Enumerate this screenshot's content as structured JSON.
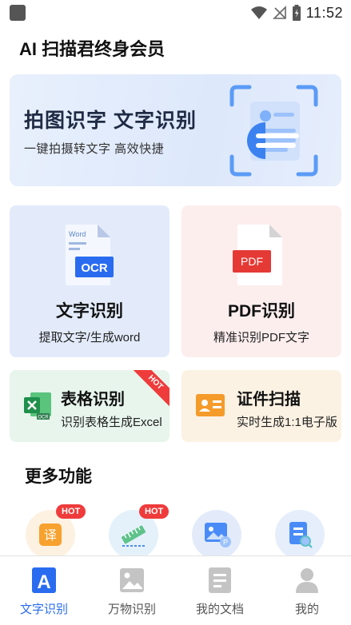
{
  "status_bar": {
    "time": "11:52",
    "icons": [
      "notification-icon",
      "wifi-icon",
      "signal-off-icon",
      "battery-charging-icon"
    ]
  },
  "header": {
    "title": "AI 扫描君终身会员"
  },
  "banner": {
    "title": "拍图识字  文字识别",
    "subtitle": "一键拍摄转文字  高效快捷",
    "accent": "#4a8cf7"
  },
  "cards": {
    "ocr": {
      "title": "文字识别",
      "subtitle": "提取文字/生成word",
      "icon_label": "OCR",
      "icon_tag": "Word",
      "icon": "ocr-document-icon"
    },
    "pdf": {
      "title": "PDF识别",
      "subtitle": "精准识别PDF文字",
      "icon_label": "PDF",
      "icon": "pdf-document-icon"
    },
    "table": {
      "title": "表格识别",
      "subtitle": "识别表格生成Excel",
      "badge": "HOT",
      "icon_tag": "OCR",
      "icon": "excel-icon"
    },
    "id": {
      "title": "证件扫描",
      "subtitle": "实时生成1:1电子版",
      "icon": "id-card-icon"
    }
  },
  "more": {
    "title": "更多功能",
    "items": [
      {
        "icon": "translate-icon",
        "glyph": "译",
        "badge": "HOT"
      },
      {
        "icon": "measure-ruler-icon",
        "badge": "HOT"
      },
      {
        "icon": "image-pdf-icon"
      },
      {
        "icon": "document-search-icon"
      }
    ]
  },
  "bottom_nav": [
    {
      "label": "文字识别",
      "icon": "text-recognition-icon",
      "glyph": "A",
      "active": true
    },
    {
      "label": "万物识别",
      "icon": "image-recognition-icon",
      "active": false
    },
    {
      "label": "我的文档",
      "icon": "my-documents-icon",
      "active": false
    },
    {
      "label": "我的",
      "icon": "profile-icon",
      "active": false
    }
  ],
  "colors": {
    "primary": "#2a6cf0",
    "hot": "#ef3b3b",
    "inactive": "#bdbdbd"
  }
}
